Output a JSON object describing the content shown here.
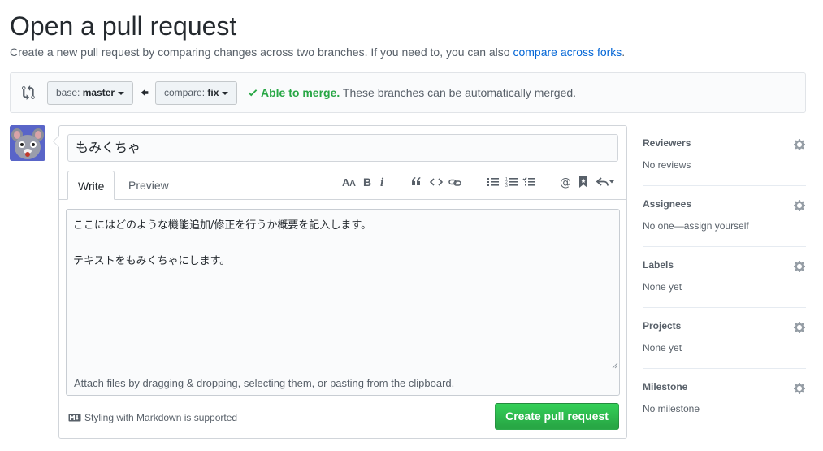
{
  "page": {
    "title": "Open a pull request",
    "subtitle_prefix": "Create a new pull request by comparing changes across two branches. If you need to, you can also ",
    "subtitle_link": "compare across forks",
    "subtitle_suffix": "."
  },
  "range": {
    "base_label": "base:",
    "base_value": "master",
    "compare_label": "compare:",
    "compare_value": "fix",
    "merge_ok": "Able to merge.",
    "merge_text": "These branches can be automatically merged."
  },
  "composer": {
    "title_value": "もみくちゃ",
    "tabs": [
      "Write",
      "Preview"
    ],
    "active_tab": "Write",
    "toolbar_icons": [
      "text-size-icon",
      "bold-icon",
      "italic-icon",
      "quote-icon",
      "code-icon",
      "link-icon",
      "bullet-list-icon",
      "numbered-list-icon",
      "task-list-icon",
      "mention-icon",
      "bookmark-icon",
      "reply-icon"
    ],
    "body_value": "ここにはどのような機能追加/修正を行うか概要を記入します。\n\nテキストをもみくちゃにします。",
    "attach_hint": "Attach files by dragging & dropping, selecting them, or pasting from the clipboard.",
    "markdown_note": "Styling with Markdown is supported",
    "submit_label": "Create pull request"
  },
  "sidebar": {
    "items": [
      {
        "heading": "Reviewers",
        "value": "No reviews"
      },
      {
        "heading": "Assignees",
        "value": "No one—assign yourself"
      },
      {
        "heading": "Labels",
        "value": "None yet"
      },
      {
        "heading": "Projects",
        "value": "None yet"
      },
      {
        "heading": "Milestone",
        "value": "No milestone"
      }
    ]
  },
  "colors": {
    "accent_link": "#0366d6",
    "success": "#28a745",
    "muted_text": "#586069",
    "border": "#d1d5da"
  }
}
